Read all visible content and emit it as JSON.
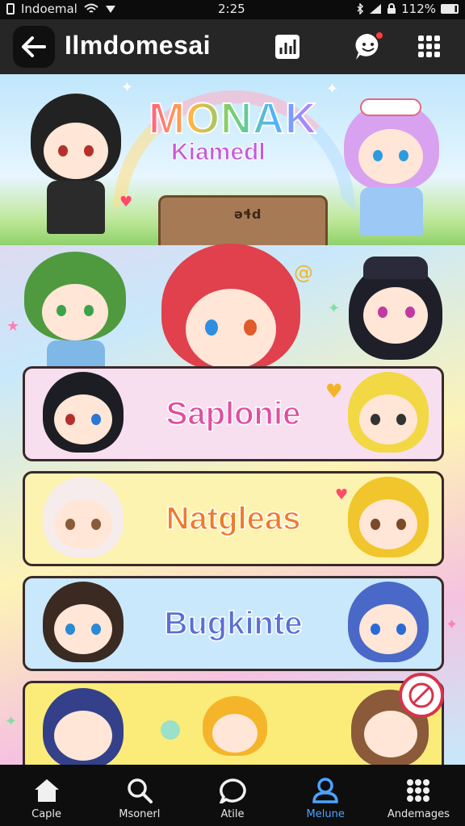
{
  "status_bar": {
    "carrier": "Indoemal",
    "time": "2:25",
    "battery": "112%"
  },
  "app_bar": {
    "title": "Ilmdomesai"
  },
  "banner": {
    "title": "MONAK",
    "subtitle": "Kiamedl",
    "board_text": "əɬd"
  },
  "list": {
    "items": [
      {
        "label": "Saplonie",
        "bg": "#f7dff0",
        "color": "#e04ea0"
      },
      {
        "label": "Natgleas",
        "bg": "#fdf3b0",
        "color": "#f07a2a"
      },
      {
        "label": "Bugkinte",
        "bg": "#c9e8fb",
        "color": "#5b6fd6"
      }
    ]
  },
  "bottom_nav": {
    "items": [
      {
        "label": "Caple",
        "icon": "home-icon"
      },
      {
        "label": "Msonerl",
        "icon": "search-icon"
      },
      {
        "label": "Atile",
        "icon": "chat-bubble-icon"
      },
      {
        "label": "Melune",
        "icon": "profile-icon",
        "active": true
      },
      {
        "label": "Andemages",
        "icon": "apps-grid-icon"
      }
    ]
  },
  "colors": {
    "accent": "#4aa4ff",
    "app_bar": "#262626",
    "notification_dot": "#ff3b3b"
  }
}
